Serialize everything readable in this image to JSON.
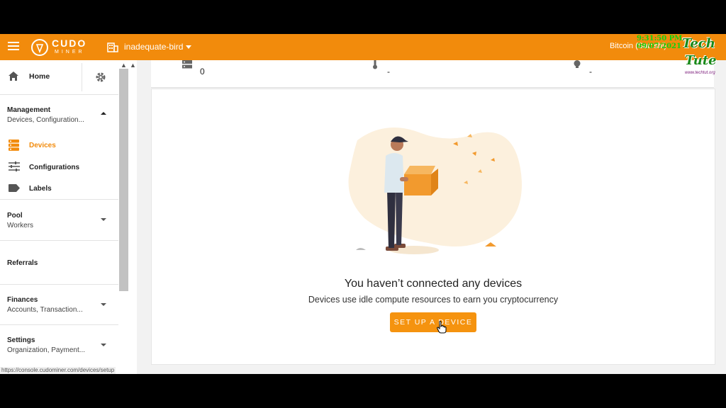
{
  "header": {
    "brand_name": "CUDO",
    "brand_sub": "MINER",
    "org_name": "inadequate-bird",
    "currency": "Bitcoin (Satoshi)"
  },
  "sidebar": {
    "home": "Home",
    "management": {
      "title": "Management",
      "subtitle": "Devices, Configuration..."
    },
    "items": [
      {
        "label": "Devices",
        "icon": "devices-icon",
        "active": true
      },
      {
        "label": "Configurations",
        "icon": "sliders-icon",
        "active": false
      },
      {
        "label": "Labels",
        "icon": "label-icon",
        "active": false
      }
    ],
    "pool": {
      "title": "Pool",
      "subtitle": "Workers"
    },
    "referrals": {
      "title": "Referrals"
    },
    "finances": {
      "title": "Finances",
      "subtitle": "Accounts, Transaction..."
    },
    "settings": {
      "title": "Settings",
      "subtitle": "Organization, Payment..."
    }
  },
  "stats": {
    "devices_count": "0",
    "temperature": "-",
    "power": "-"
  },
  "empty_state": {
    "title": "You haven’t connected any devices",
    "subtitle": "Devices use idle compute resources to earn you cryptocurrency",
    "button": "SET UP A DEVICE"
  },
  "status_url": "https://console.cudominer.com/devices/setup",
  "overlay": {
    "clock": "9:31:50 PM 09/07/2021",
    "logo_line1": "Tech",
    "logo_line2": "Tute",
    "site": "www.techtut.org"
  },
  "colors": {
    "accent": "#f28b0c",
    "button": "#f5930f",
    "active_text": "#f28b0c"
  }
}
